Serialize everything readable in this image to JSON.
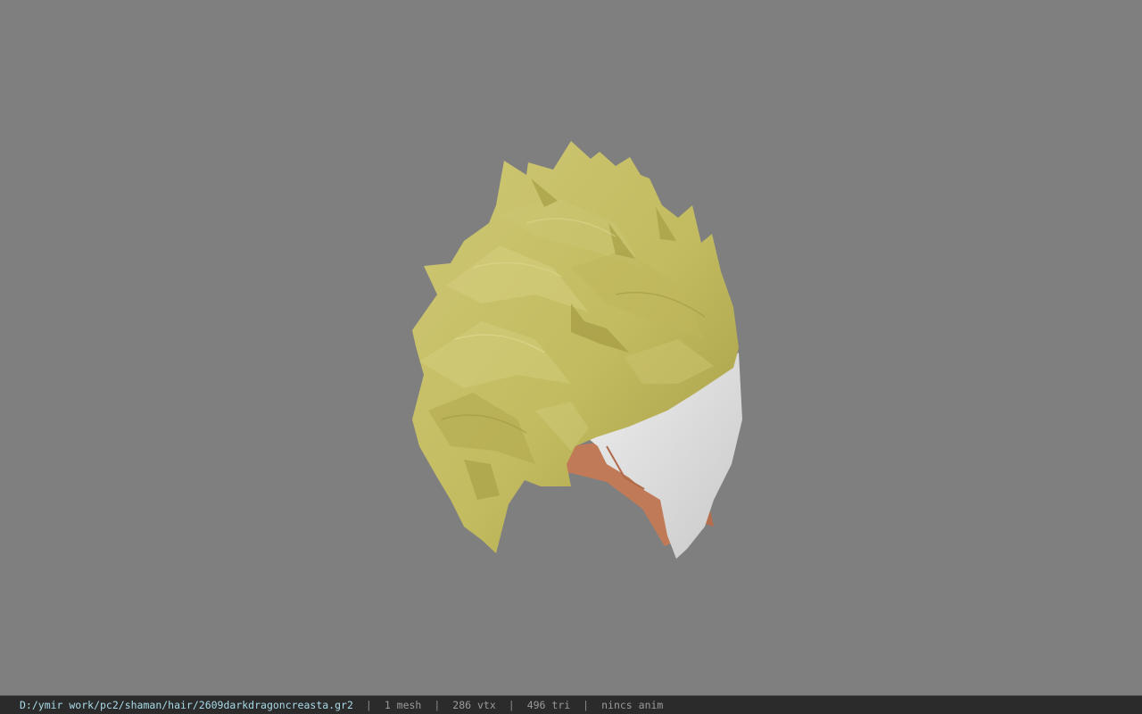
{
  "viewer": {
    "background_color": "#7f7f7f",
    "model_icon": "hair-mesh-model",
    "hair_color": "#c8c166",
    "band_color": "#dcdcdc",
    "skin_color": "#c68563"
  },
  "status": {
    "file_path": "D:/ymir work/pc2/shaman/hair/2609darkdragoncreasta.gr2",
    "separator": "|",
    "mesh_count": "1 mesh",
    "vertex_count": "286 vtx",
    "triangle_count": "496 tri",
    "animation": "nincs anim"
  }
}
